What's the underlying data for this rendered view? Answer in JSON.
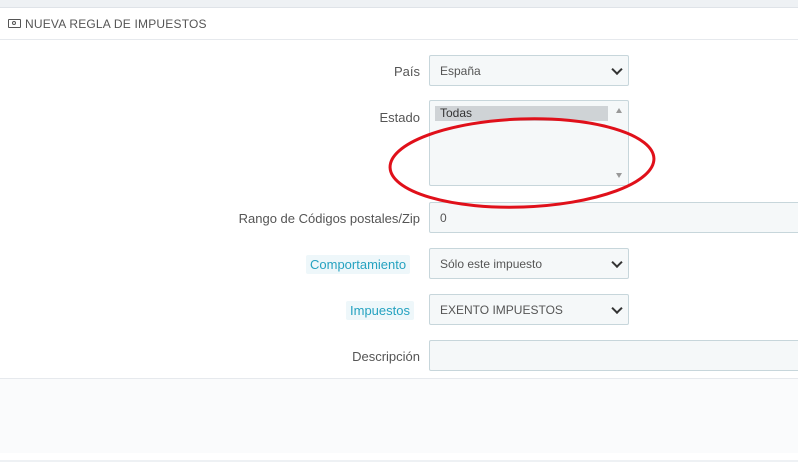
{
  "panel": {
    "title": "NUEVA REGLA DE IMPUESTOS",
    "icon": "money-icon"
  },
  "form": {
    "country": {
      "label": "País",
      "value": "España"
    },
    "state": {
      "label": "Estado",
      "options": [
        "Todas"
      ],
      "selected": "Todas"
    },
    "zip_range": {
      "label": "Rango de Códigos postales/Zip",
      "value": "0"
    },
    "behavior": {
      "label": "Comportamiento",
      "value": "Sólo este impuesto"
    },
    "tax": {
      "label": "Impuestos",
      "value": "EXENTO IMPUESTOS"
    },
    "description": {
      "label": "Descripción",
      "value": ""
    }
  },
  "colors": {
    "hint_text": "#25a2c0",
    "annotation": "#e0101a"
  }
}
